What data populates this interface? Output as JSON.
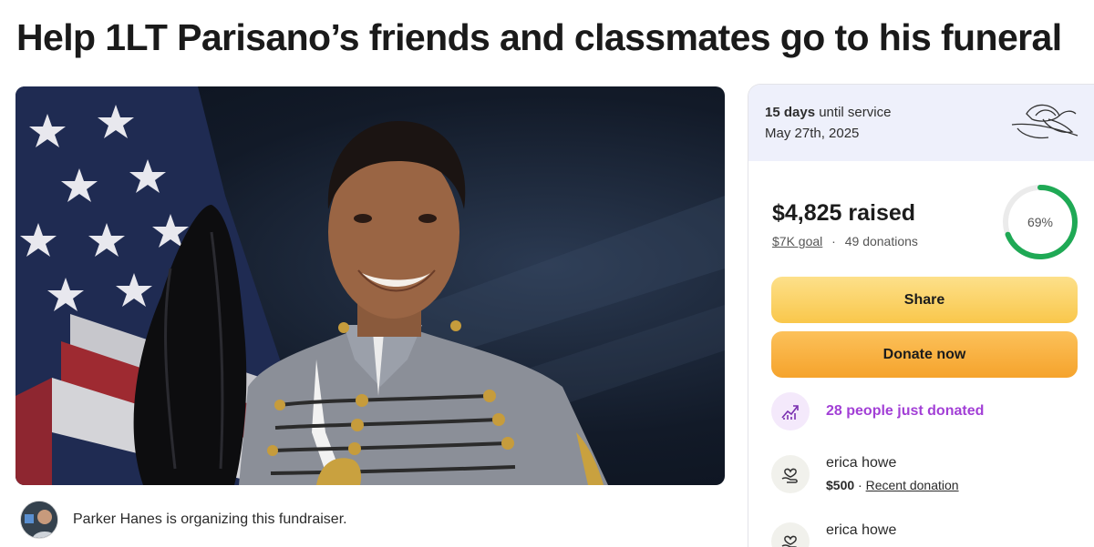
{
  "page": {
    "title": "Help 1LT Parisano’s friends and classmates go to his funeral"
  },
  "organizer": {
    "text": "Parker Hanes is organizing this fundraiser."
  },
  "service": {
    "days": "15 days",
    "until": "until service",
    "date": "May 27th, 2025"
  },
  "progress": {
    "raised": "$4,825 raised",
    "goal": "$7K goal",
    "separator": "·",
    "donations": "49 donations",
    "percent_label": "69%",
    "fraction": 0.69
  },
  "buttons": {
    "share": "Share",
    "donate": "Donate now"
  },
  "activity": {
    "text": "28 people just donated"
  },
  "donors": [
    {
      "name": "erica howe",
      "amount": "$500",
      "separator": " · ",
      "tag": "Recent donation"
    },
    {
      "name": "erica howe"
    }
  ],
  "colors": {
    "ring": "#1fa955",
    "activity": "#a23fd6",
    "share_button": "#f9c74b",
    "donate_button": "#f5a32c"
  },
  "icons": {
    "lily": "lily-flower-icon",
    "trend": "trending-up-icon",
    "heart_hand": "heart-hand-icon"
  }
}
